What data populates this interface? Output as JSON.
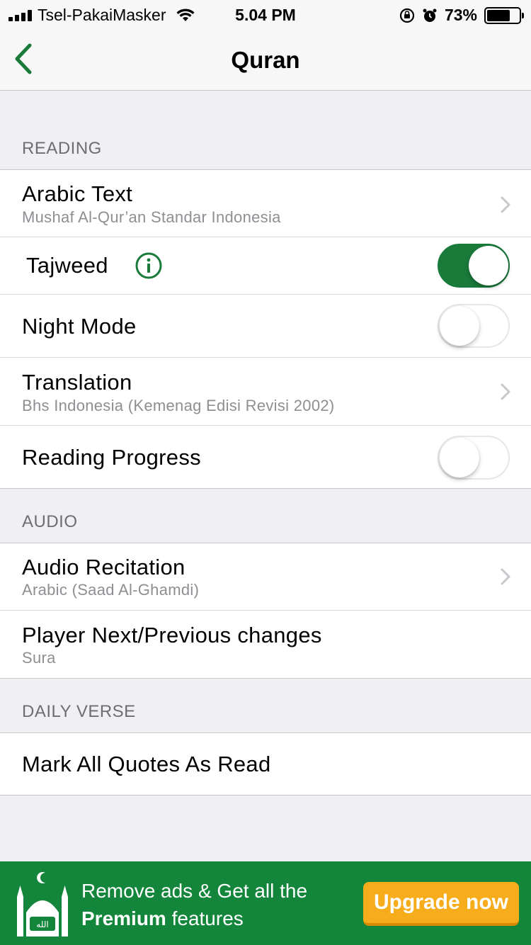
{
  "status_bar": {
    "carrier": "Tsel-PakaiMasker",
    "time": "5.04 PM",
    "battery_text": "73%",
    "battery_level": 0.73
  },
  "nav": {
    "title": "Quran",
    "back_icon": "chevron-left-icon"
  },
  "colors": {
    "accent_green": "#1a7a3a",
    "banner_green": "#14863c",
    "upgrade_orange": "#f6ac1b"
  },
  "sections": {
    "reading": {
      "header": "READING",
      "arabic_text": {
        "title": "Arabic Text",
        "subtitle": "Mushaf Al-Qur’an Standar Indonesia"
      },
      "tajweed": {
        "title": "Tajweed",
        "enabled": true
      },
      "night_mode": {
        "title": "Night Mode",
        "enabled": false
      },
      "translation": {
        "title": "Translation",
        "subtitle": "Bhs Indonesia (Kemenag Edisi Revisi 2002)"
      },
      "reading_progress": {
        "title": "Reading Progress",
        "enabled": false
      }
    },
    "audio": {
      "header": "AUDIO",
      "audio_recitation": {
        "title": "Audio Recitation",
        "subtitle": "Arabic (Saad Al-Ghamdi)"
      },
      "player_changes": {
        "title": "Player Next/Previous changes",
        "subtitle": "Sura"
      }
    },
    "daily_verse": {
      "header": "DAILY VERSE",
      "mark_all": {
        "title": "Mark All Quotes As Read"
      }
    }
  },
  "banner": {
    "line1": "Remove ads & Get all the",
    "line2_bold": "Premium",
    "line2_rest": " features",
    "button_label": "Upgrade now"
  }
}
